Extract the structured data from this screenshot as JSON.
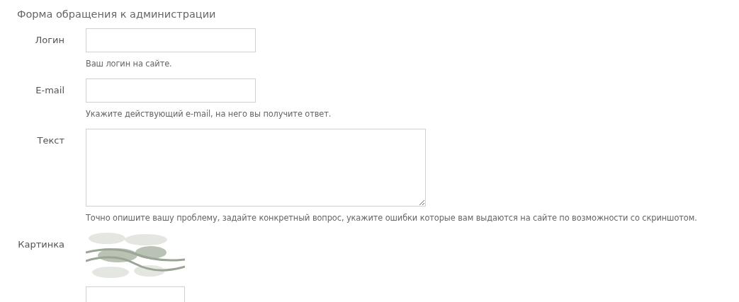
{
  "form": {
    "title": "Форма обращения к администрации",
    "fields": [
      {
        "kind": "input",
        "label": "Логин",
        "help": "Ваш логин на сайте."
      },
      {
        "kind": "input",
        "label": "E-mail",
        "help": "Укажите действующий e-mail, на него вы получите ответ."
      },
      {
        "kind": "textarea",
        "label": "Текст",
        "help": "Точно опишите вашу проблему, задайте конкретный вопрос, укажите ошибки которые вам выдаются на сайте по возможности со скриншотом."
      },
      {
        "kind": "captcha",
        "label": "Картинка"
      }
    ]
  }
}
